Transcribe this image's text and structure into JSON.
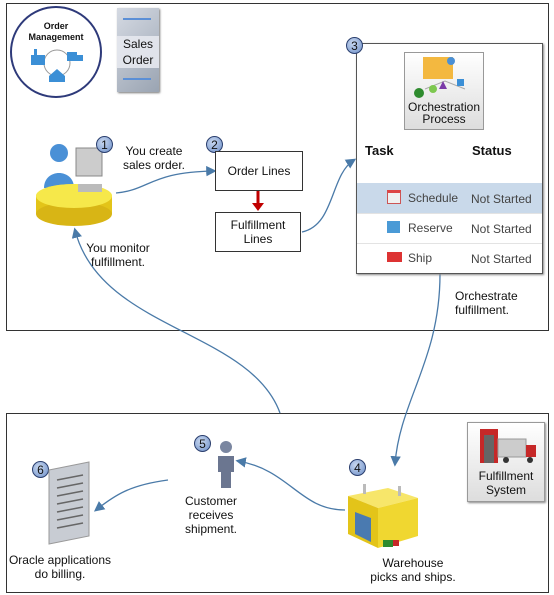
{
  "header": {
    "order_management": "Order Management",
    "sales_order": "Sales Order"
  },
  "steps": {
    "s1": {
      "badge": "1",
      "text": "You create sales order."
    },
    "s2": {
      "badge": "2",
      "order_lines": "Order Lines",
      "fulfillment_lines": "Fulfillment Lines"
    },
    "s3": {
      "badge": "3",
      "icon_label": "Orchestration Process"
    },
    "s4": {
      "badge": "4",
      "text": "Warehouse picks and ships."
    },
    "s5": {
      "badge": "5",
      "text": "Customer receives shipment."
    },
    "s6": {
      "badge": "6",
      "text": "Oracle applications do billing."
    }
  },
  "table": {
    "headers": [
      "Task",
      "Status"
    ],
    "rows": [
      {
        "task": "Schedule",
        "status": "Not Started",
        "icon": "calendar-clock-icon",
        "highlighted": true
      },
      {
        "task": "Reserve",
        "status": "Not Started",
        "icon": "box-lock-icon"
      },
      {
        "task": "Ship",
        "status": "Not Started",
        "icon": "truck-icon"
      }
    ]
  },
  "notes": {
    "monitor": "You monitor fulfillment.",
    "orchestrate": "Orchestrate fulfillment."
  },
  "fulfillment_system": "Fulfillment System",
  "colors": {
    "arrow": "#4a7aa8",
    "red_arrow": "#c00000",
    "highlight": "#c9d9ea",
    "badge": "#6d8fc8"
  }
}
